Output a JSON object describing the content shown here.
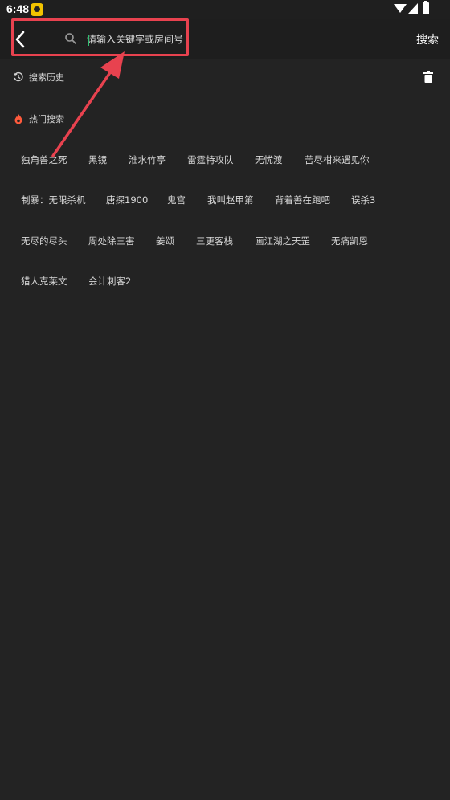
{
  "status_bar": {
    "time": "6:48"
  },
  "header": {
    "search_placeholder": "请输入关键字或房间号",
    "search_button": "搜索"
  },
  "history": {
    "title": "搜索历史"
  },
  "hot": {
    "title": "热门搜索",
    "tags": [
      "独角兽之死",
      "黑镜",
      "淮水竹亭",
      "雷霆特攻队",
      "无忧渡",
      "苦尽柑来遇见你",
      "制暴：无限杀机",
      "唐探1900",
      "鬼宫",
      "我叫赵甲第",
      "背着善在跑吧",
      "误杀3",
      "无尽的尽头",
      "周处除三害",
      "姜颂",
      "三更客栈",
      "画江湖之天罡",
      "无痛凯恩",
      "猎人克莱文",
      "会计刺客2"
    ]
  },
  "colors": {
    "background": "#232323",
    "header": "#1e1e1e",
    "annotation_red": "#e8424f",
    "hot_icon": "#ff5a3c",
    "caret": "#2fbf71"
  },
  "icons": [
    "back-icon",
    "search-icon",
    "history-icon",
    "fire-icon",
    "trash-icon",
    "wifi-icon",
    "signal-icon",
    "battery-icon"
  ]
}
